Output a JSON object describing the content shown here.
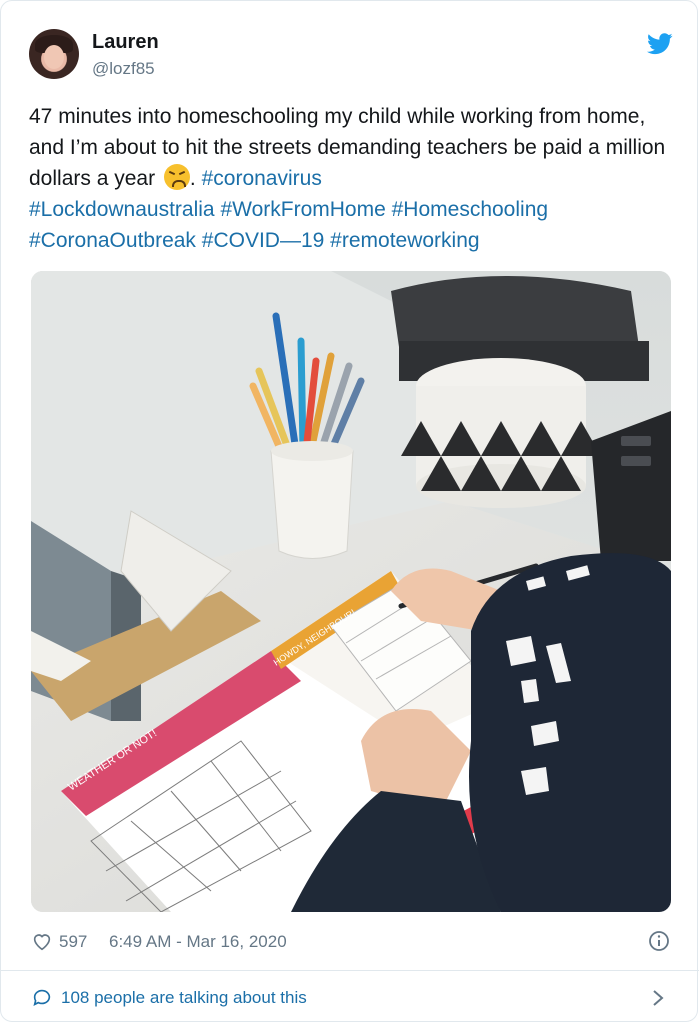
{
  "user": {
    "display_name": "Lauren",
    "handle": "@lozf85"
  },
  "tweet": {
    "text": "47 minutes into homeschooling my child while working from home, and I’m about to hit the streets demanding teachers be paid a million dollars a year",
    "emoji": "persevering-face",
    "after_emoji": ".",
    "hashtags": [
      "#coronavirus",
      "#Lockdownaustralia",
      "#WorkFromHome",
      "#Homeschooling",
      "#CoronaOutbreak",
      "#COVID—19",
      "#remoteworking"
    ]
  },
  "media": {
    "worksheet_heading_left": "WEATHER OR NOT!",
    "worksheet_heading_right": "HOWDY, NEIGHBOUR!"
  },
  "meta": {
    "likes": "597",
    "timestamp": "6:49 AM - Mar 16, 2020"
  },
  "footer": {
    "talking": "108 people are talking about this"
  },
  "colors": {
    "link": "#1b6fa8",
    "twitter_blue": "#1da1f2",
    "secondary_text": "#657786"
  }
}
